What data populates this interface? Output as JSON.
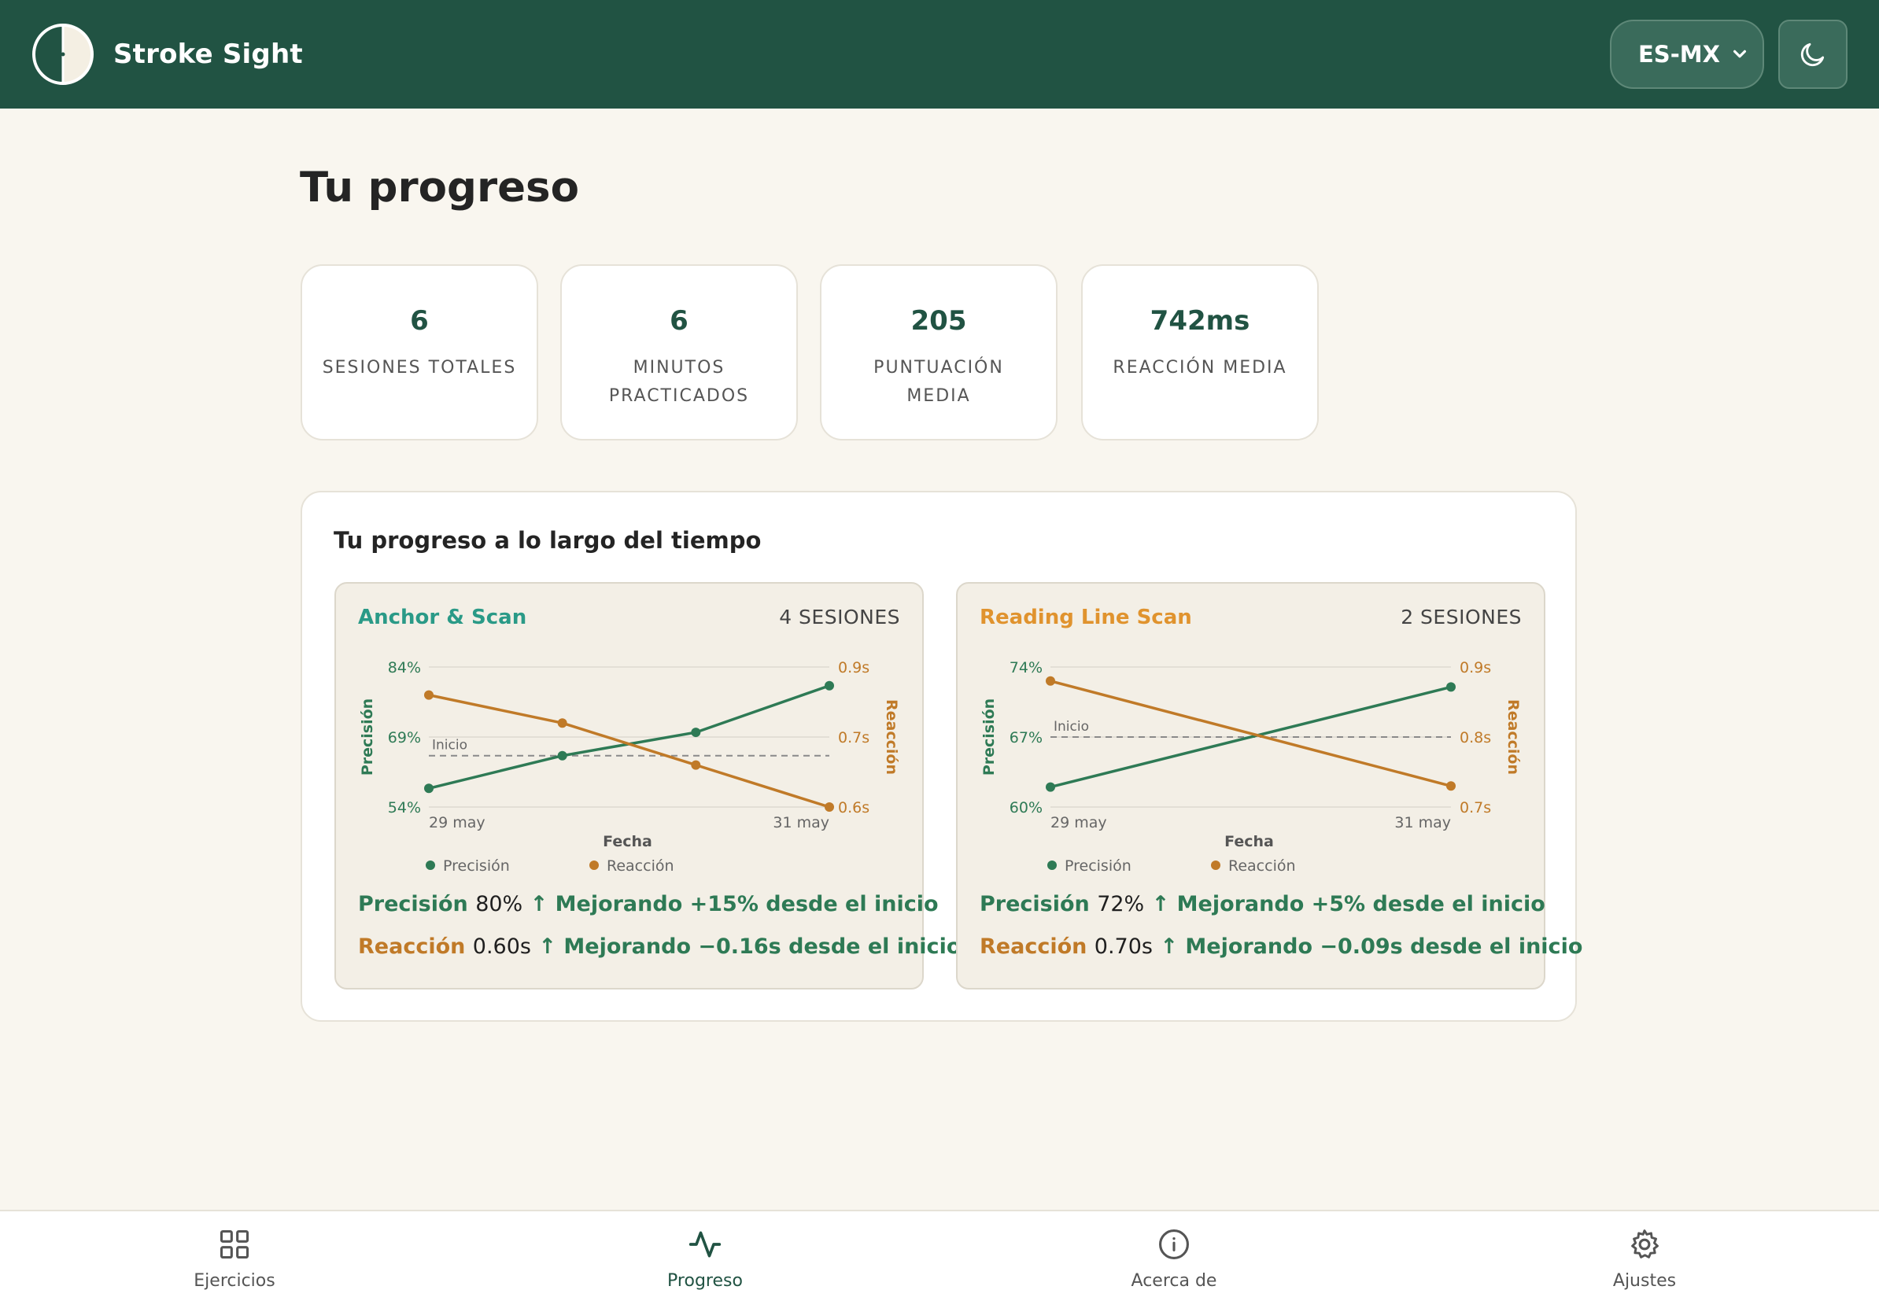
{
  "header": {
    "app_name": "Stroke Sight",
    "language": "ES-MX",
    "logo_icon": "half-circle-icon",
    "theme_icon": "moon-icon"
  },
  "colors": {
    "header_bg": "#215343",
    "page_bg": "#f9f6ef",
    "accuracy": "#2e7a55",
    "reaction": "#c07a28",
    "anchor_title": "#2a9a87",
    "reading_title": "#e0932e"
  },
  "page": {
    "title": "Tu progreso"
  },
  "stats": [
    {
      "value": "6",
      "label": "Sesiones totales"
    },
    {
      "value": "6",
      "label": "Minutos practicados"
    },
    {
      "value": "205",
      "label": "Puntuación media"
    },
    {
      "value": "742ms",
      "label": "Reacción media"
    }
  ],
  "progress": {
    "title": "Tu progreso a lo largo del tiempo",
    "exercises": [
      {
        "name": "Anchor & Scan",
        "sessions": "4 sesiones",
        "accuracy_label": "Precisión",
        "accuracy_value": "80%",
        "accuracy_trend": "↑ Mejorando +15% desde el inicio",
        "reaction_label": "Reacción",
        "reaction_value": "0.60s",
        "reaction_trend": "↑ Mejorando −0.16s desde el inicio"
      },
      {
        "name": "Reading Line Scan",
        "sessions": "2 sesiones",
        "accuracy_label": "Precisión",
        "accuracy_value": "72%",
        "accuracy_trend": "↑ Mejorando +5% desde el inicio",
        "reaction_label": "Reacción",
        "reaction_value": "0.70s",
        "reaction_trend": "↑ Mejorando −0.09s desde el inicio"
      }
    ]
  },
  "chart_data": [
    {
      "type": "line",
      "xlabel": "Fecha",
      "x_ticks": [
        "29 may",
        "31 may"
      ],
      "y_left": {
        "label": "Precisión",
        "ticks": [
          "54%",
          "69%",
          "84%"
        ],
        "range": [
          54,
          84
        ]
      },
      "y_right": {
        "label": "Reacción",
        "ticks": [
          "0.6s",
          "0.7s",
          "0.9s"
        ],
        "range": [
          0.6,
          0.9
        ]
      },
      "baseline_label": "Inicio",
      "baseline_accuracy": 65,
      "series": [
        {
          "name": "Precisión",
          "axis": "left",
          "color": "#2e7a55",
          "values": [
            58,
            65,
            70,
            80
          ]
        },
        {
          "name": "Reacción",
          "axis": "right",
          "color": "#c07a28",
          "values": [
            0.84,
            0.78,
            0.69,
            0.6
          ]
        }
      ],
      "legend": "bottom"
    },
    {
      "type": "line",
      "xlabel": "Fecha",
      "x_ticks": [
        "29 may",
        "31 may"
      ],
      "y_left": {
        "label": "Precisión",
        "ticks": [
          "60%",
          "67%",
          "74%"
        ],
        "range": [
          60,
          74
        ]
      },
      "y_right": {
        "label": "Reacción",
        "ticks": [
          "0.7s",
          "0.8s",
          "0.9s"
        ],
        "range": [
          0.7,
          0.9
        ]
      },
      "baseline_label": "Inicio",
      "baseline_accuracy": 67,
      "series": [
        {
          "name": "Precisión",
          "axis": "left",
          "color": "#2e7a55",
          "values": [
            62,
            72
          ]
        },
        {
          "name": "Reacción",
          "axis": "right",
          "color": "#c07a28",
          "values": [
            0.88,
            0.73
          ]
        }
      ],
      "legend": "bottom"
    }
  ],
  "nav": [
    {
      "label": "Ejercicios",
      "icon": "grid-icon"
    },
    {
      "label": "Progreso",
      "icon": "activity-icon"
    },
    {
      "label": "Acerca de",
      "icon": "info-icon"
    },
    {
      "label": "Ajustes",
      "icon": "gear-icon"
    }
  ]
}
